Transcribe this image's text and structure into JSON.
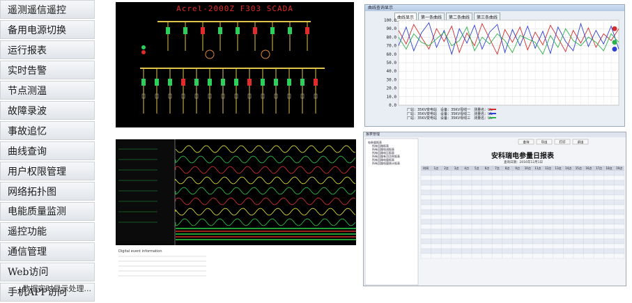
{
  "menu": {
    "items": [
      {
        "label": "遥测遥信遥控"
      },
      {
        "label": "备用电源切换"
      },
      {
        "label": "运行报表"
      },
      {
        "label": "实时告警"
      },
      {
        "label": "节点测温"
      },
      {
        "label": "故障录波"
      },
      {
        "label": "事故追忆"
      },
      {
        "label": "曲线查询"
      },
      {
        "label": "用户权限管理"
      },
      {
        "label": "网络拓扑图"
      },
      {
        "label": "电能质量监测"
      },
      {
        "label": "遥控功能"
      },
      {
        "label": "通信管理"
      },
      {
        "label": "Web访问"
      },
      {
        "label": "手机APP访问"
      }
    ]
  },
  "footer": {
    "text": "...数据实时显示处理..."
  },
  "scada": {
    "title": "Acrel-2000Z F303 SCADA",
    "colors": {
      "background": "#000000",
      "bus": "#e3c44a",
      "breaker_on": "#2bd15a",
      "breaker_off": "#e32b2b"
    }
  },
  "curve": {
    "window_title": "曲线查询显示",
    "tabs": [
      {
        "label": "曲线显示"
      },
      {
        "label": "第一条曲线"
      },
      {
        "label": "第二条曲线"
      },
      {
        "label": "第三条曲线"
      }
    ],
    "legend": [
      {
        "label": "厂站：35KV变电站　设备：35KV母线一　测量名：Ua",
        "color": "#d62b2b"
      },
      {
        "label": "厂站：35KV变电站　设备：35KV母线二　测量名：Ub",
        "color": "#2b3fd6"
      },
      {
        "label": "厂站：35KV变电站　设备：35KV母线三　测量名：Uc",
        "color": "#2bb14a"
      }
    ]
  },
  "chart_data": {
    "type": "line",
    "title": "",
    "xlabel": "",
    "ylabel": "",
    "ylim": [
      0,
      100
    ],
    "y_ticks": [
      "100.0",
      "90.0",
      "80.0",
      "70.0",
      "60.0",
      "50.0",
      "40.0",
      "30.0",
      "20.0",
      "10.0",
      "0.0"
    ],
    "grid": true,
    "x": [
      1,
      2,
      3,
      4,
      5,
      6,
      7,
      8,
      9,
      10,
      11,
      12,
      13,
      14,
      15,
      16,
      17,
      18,
      19,
      20,
      21,
      22,
      23,
      24,
      25,
      26,
      27,
      28,
      29,
      30
    ],
    "series": [
      {
        "color": "#d62b2b",
        "values": [
          88,
          72,
          95,
          80,
          66,
          90,
          75,
          93,
          62,
          85,
          70,
          96,
          78,
          60,
          89,
          74,
          92,
          65,
          86,
          71,
          94,
          79,
          63,
          88,
          73,
          91,
          68,
          84,
          76,
          90
        ]
      },
      {
        "color": "#2b3fd6",
        "values": [
          70,
          92,
          64,
          85,
          97,
          68,
          88,
          60,
          90,
          73,
          94,
          66,
          86,
          95,
          62,
          89,
          70,
          93,
          67,
          87,
          61,
          92,
          75,
          64,
          96,
          69,
          88,
          72,
          93,
          66
        ]
      },
      {
        "color": "#2bb14a",
        "values": [
          80,
          66,
          84,
          74,
          70,
          78,
          86,
          70,
          76,
          92,
          64,
          80,
          72,
          84,
          76,
          62,
          82,
          78,
          74,
          60,
          82,
          68,
          90,
          76,
          70,
          80,
          74,
          64,
          84,
          74
        ]
      }
    ]
  },
  "wave": {
    "trace_colors": [
      "#f2f233",
      "#2fd14a",
      "#e3323a",
      "#f2f233",
      "#2fd14a",
      "#e3323a",
      "#f2f233",
      "#2fd14a"
    ],
    "event_info_label": "Digital event information"
  },
  "report": {
    "window_title": "报表管理",
    "heading": "安科瑞电参量日报表",
    "subheading": "查询日期：2016年12月1日",
    "toolbar": {
      "query": "查询",
      "export": "导出",
      "print": "打印",
      "exit": "退出"
    },
    "tree": [
      "电参量报表",
      "所有回路报表",
      "所有回路电流报表",
      "所有回路电压报表",
      "所有回路有功功率报表",
      "所有回路电量报表",
      "所有回路电量统计报表"
    ],
    "columns": [
      "时间",
      "1点",
      "2点",
      "3点",
      "4点",
      "5点",
      "6点",
      "7点",
      "8点",
      "9点",
      "10点",
      "11点",
      "12点",
      "13点",
      "14点",
      "15点",
      "16点",
      "17点",
      "18点",
      "19点"
    ],
    "row_count": 18
  }
}
